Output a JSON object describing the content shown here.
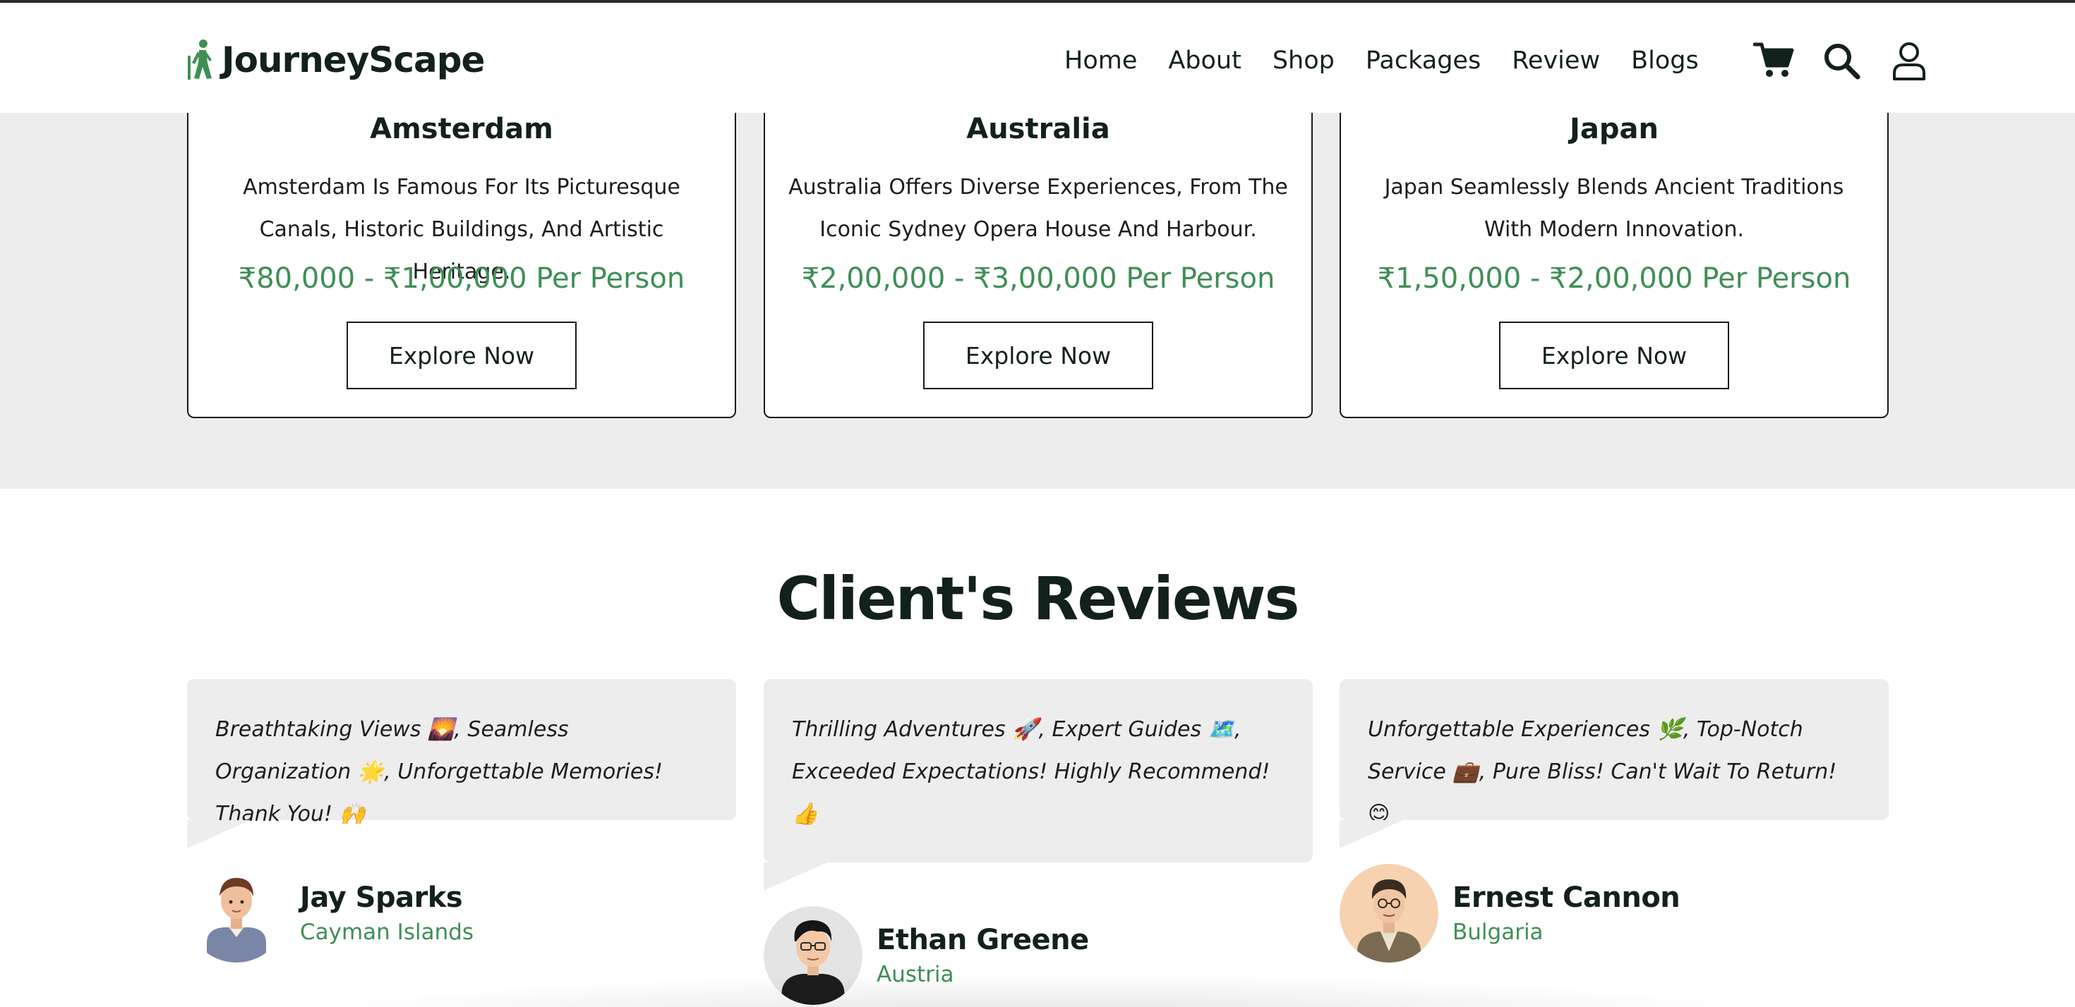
{
  "header": {
    "logo_text": "JourneyScape",
    "nav": [
      "Home",
      "About",
      "Shop",
      "Packages",
      "Review",
      "Blogs"
    ],
    "icons": [
      "cart-icon",
      "search-icon",
      "user-icon"
    ]
  },
  "packages": [
    {
      "title": "Amsterdam",
      "description": "Amsterdam Is Famous For Its Picturesque Canals, Historic Buildings, And Artistic Heritage.",
      "price": "₹80,000 - ₹1,00,000 Per Person",
      "button": "Explore Now"
    },
    {
      "title": "Australia",
      "description": "Australia Offers Diverse Experiences, From The Iconic Sydney Opera House And Harbour.",
      "price": "₹2,00,000 - ₹3,00,000 Per Person",
      "button": "Explore Now"
    },
    {
      "title": "Japan",
      "description": "Japan Seamlessly Blends Ancient Traditions With Modern Innovation.",
      "price": "₹1,50,000 - ₹2,00,000 Per Person",
      "button": "Explore Now"
    }
  ],
  "reviews": {
    "title": "Client's Reviews",
    "items": [
      {
        "text": "Breathtaking Views 🌄, Seamless Organization 🌟, Unforgettable Memories! Thank You! 🙌",
        "name": "Jay Sparks",
        "location": "Cayman Islands"
      },
      {
        "text": "Thrilling Adventures 🚀, Expert Guides 🗺️, Exceeded Expectations! Highly Recommend! 👍",
        "name": "Ethan Greene",
        "location": "Austria"
      },
      {
        "text": "Unforgettable Experiences 🌿, Top-Notch Service 💼, Pure Bliss! Can't Wait To Return! 😊",
        "name": "Ernest Cannon",
        "location": "Bulgaria"
      }
    ]
  },
  "colors": {
    "accent_green": "#3f8f55",
    "dark_text": "#13211c",
    "band_gray": "#ededed"
  }
}
